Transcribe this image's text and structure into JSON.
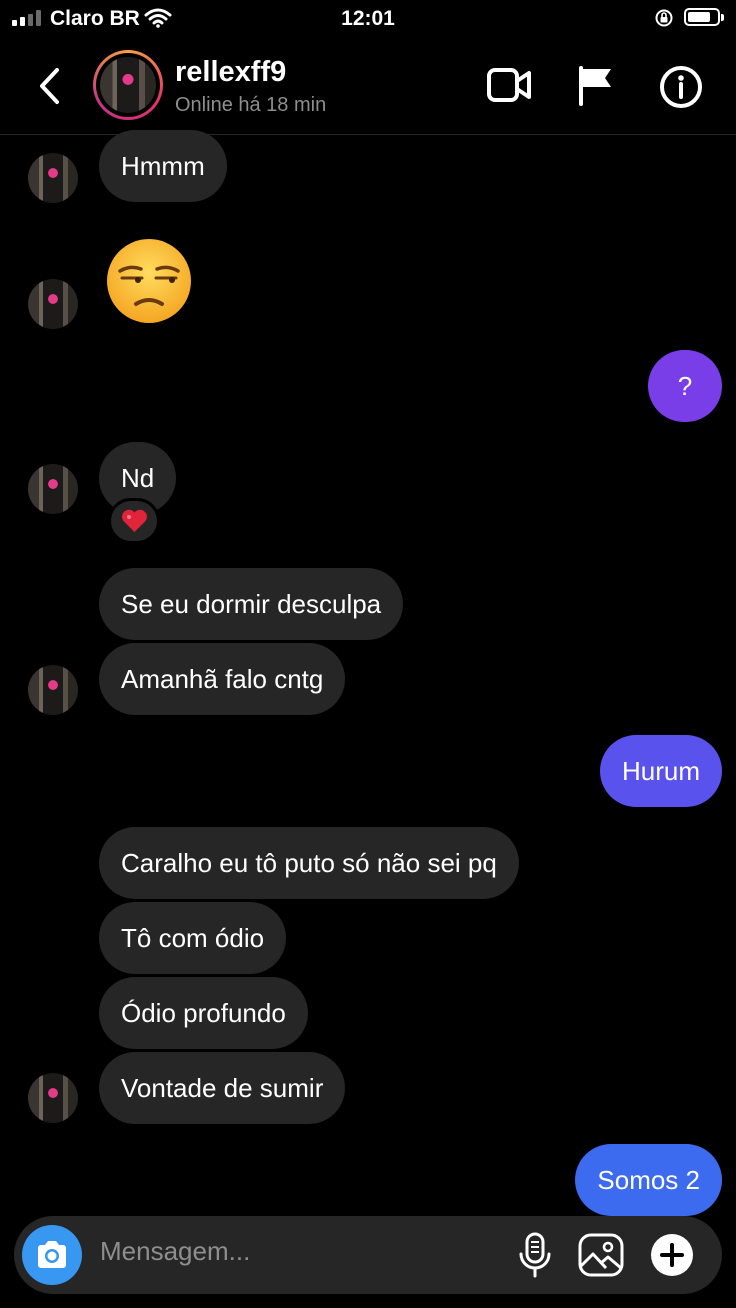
{
  "status_bar": {
    "carrier": "Claro BR",
    "time": "12:01",
    "battery_level": 0.78
  },
  "header": {
    "username": "rellexff9",
    "presence": "Online há 18 min"
  },
  "messages": [
    {
      "side": "received",
      "text": "Hmmm"
    },
    {
      "side": "received",
      "type": "emoji",
      "emoji": "unamused-face"
    },
    {
      "side": "sent",
      "text": "?"
    },
    {
      "side": "received",
      "text": "Nd",
      "reaction": "red-heart"
    },
    {
      "side": "received",
      "text": "Se eu dormir desculpa"
    },
    {
      "side": "received",
      "text": "Amanhã falo cntg"
    },
    {
      "side": "sent",
      "text": "Hurum"
    },
    {
      "side": "received",
      "text": "Caralho eu tô puto só não sei pq"
    },
    {
      "side": "received",
      "text": "Tô com ódio"
    },
    {
      "side": "received",
      "text": "Ódio profundo"
    },
    {
      "side": "received",
      "text": "Vontade de sumir"
    },
    {
      "side": "sent",
      "text": "Somos 2"
    }
  ],
  "composer": {
    "placeholder": "Mensagem..."
  },
  "icons": {
    "back": "chevron-left-icon",
    "video_call": "video-camera-icon",
    "report": "flag-icon",
    "info": "info-icon",
    "camera": "camera-icon",
    "microphone": "microphone-icon",
    "gallery": "gallery-icon",
    "more": "plus-icon"
  },
  "colors": {
    "background": "#000000",
    "received_bubble": "#262626",
    "sent_bubble_question": "#7a3ee8",
    "sent_bubble_hurum": "#5a52ec",
    "sent_bubble_somos": "#3d6bf0",
    "camera_button": "#3897f0",
    "muted_text": "#8e8e8e"
  }
}
